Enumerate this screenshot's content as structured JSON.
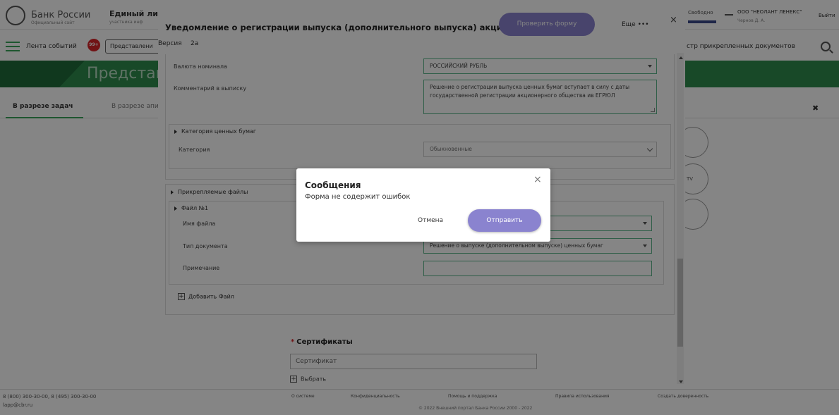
{
  "background": {
    "logo_text": "Банк России",
    "logo_sub": "Официальный сайт",
    "portal_title": "Единый ли",
    "portal_sub": "участника инф",
    "right_link": "Свободно",
    "company": "ООО \"НЕОЛАНТ ЛЕНЕКС\"",
    "user": "Чернов Д. А.",
    "exit": "Выйти",
    "feed": "Лента событий",
    "badge": "99+",
    "represent": "Представлени",
    "registry": "стр прикрепленных документов",
    "banner": "Представл",
    "tab1": "В разрезе задач",
    "tab2": "В разрезе апи",
    "circle_text": "TV",
    "close_x": "✖",
    "phone": "8 (800) 300-30-00, 8 (495) 300-30-00",
    "email": "lapp@cbr.ru",
    "footer_links": [
      "О системе",
      "Конфиденциальность",
      "Помощь и поддержка",
      "Правила использования",
      "Создать доверенность"
    ],
    "copyright": "© 2022 Внешний портал Банка России 2000 - 2022"
  },
  "dialog": {
    "title": "Уведомление о регистрации выпуска (дополнительного выпуска) акций",
    "check_button": "Проверить форму",
    "more": "Еще",
    "more_icon": "•••",
    "close_icon": "×",
    "version_label": "Версия",
    "version_value": "2а",
    "fields": {
      "currency_label": "Валюта номинала",
      "currency_value": "РОССИЙСКИЙ РУБЛЬ",
      "comment_label": "Комментарий в выписку",
      "comment_value": "Решение о регистрации выпуска ценных бумаг вступает в силу с даты государственной регистрации акционерного общества ив ЕГРЮЛ",
      "category_section": "Категория ценных бумаг",
      "category_label": "Категория",
      "category_value": "Обыкновенные",
      "files_section": "Прикрепляемые файлы",
      "file_section": "Файл №1",
      "filename_label": "Имя файла",
      "doctype_label": "Тип документа",
      "doctype_value": "Решение о выпуске (дополнительном выпуске) ценных бумаг",
      "note_label": "Примечание",
      "add_file": "Добавить Файл"
    },
    "certificates": {
      "required_mark": "*",
      "label": "Сертификаты",
      "placeholder": "Сертификат",
      "choose": "Выбрать"
    }
  },
  "messages": {
    "title": "Сообщения",
    "text": "Форма не содержит ошибок",
    "close_icon": "×",
    "cancel": "Отмена",
    "send": "Отправить"
  }
}
